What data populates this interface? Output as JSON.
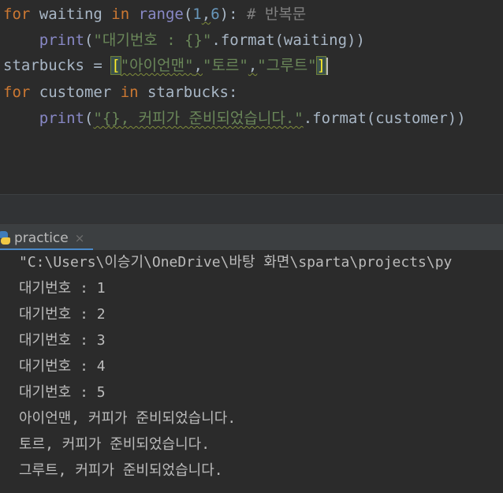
{
  "editor": {
    "line1": {
      "kw_for": "for",
      "var": " waiting ",
      "kw_in": "in",
      "sp": " ",
      "fn_range": "range",
      "paren_open": "(",
      "num1": "1",
      "comma": ",",
      "num2": "6",
      "paren_close": "):",
      "comment": " # 반복문"
    },
    "line2": {
      "indent": "    ",
      "fn_print": "print",
      "open": "(",
      "string": "\"대기번호 : {}\"",
      "rest": ".format(waiting))"
    },
    "line3": {
      "var": "starbucks = ",
      "bracket_open": "[",
      "s1": "\"아이언맨\"",
      "c1": ",",
      "s2": "\"토르\"",
      "c2": ",",
      "s3": "\"그루트\"",
      "bracket_close": "]"
    },
    "line4": {
      "kw_for": "for",
      "var": " customer ",
      "kw_in": "in",
      "rest": " starbucks:"
    },
    "line5": {
      "indent": "    ",
      "fn_print": "print",
      "open": "(",
      "string": "\"{}, 커피가 준비되었습니다.\"",
      "rest": ".format(customer))"
    }
  },
  "run_panel": {
    "tab_label": "practice",
    "close_glyph": "×",
    "icon": "python-icon"
  },
  "console": {
    "lines": [
      "\"C:\\Users\\이승기\\OneDrive\\바탕 화면\\sparta\\projects\\py",
      "대기번호 : 1",
      "대기번호 : 2",
      "대기번호 : 3",
      "대기번호 : 4",
      "대기번호 : 5",
      "아이언맨, 커피가 준비되었습니다.",
      "토르, 커피가 준비되었습니다.",
      "그루트, 커피가 준비되었습니다."
    ]
  },
  "colors": {
    "background": "#2b2b2b",
    "keyword": "#cc7832",
    "string": "#6a8759",
    "number": "#6897bb",
    "builtin": "#8888c6",
    "comment": "#808080",
    "text": "#a9b7c6",
    "console_text": "#bbbbbb"
  }
}
